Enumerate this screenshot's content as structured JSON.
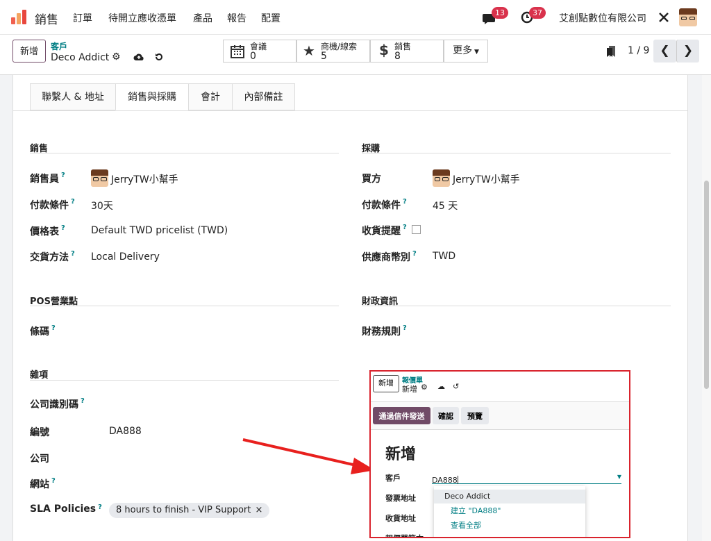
{
  "topbar": {
    "app_name": "銷售",
    "menu": [
      "訂單",
      "待開立應收憑單",
      "產品",
      "報告",
      "配置"
    ],
    "messages_count": "13",
    "activities_count": "37",
    "company": "艾創點數位有限公司"
  },
  "control_panel": {
    "new_label": "新增",
    "breadcrumb_parent": "客戶",
    "record_name": "Deco Addict",
    "smart_buttons": [
      {
        "label": "會議",
        "value": "0",
        "icon": "calendar-icon"
      },
      {
        "label": "商機/線索",
        "value": "5",
        "icon": "star-icon"
      },
      {
        "label": "銷售",
        "value": "8",
        "icon": "dollar-icon"
      }
    ],
    "more_label": "更多",
    "pager": "1 / 9"
  },
  "tabs": [
    "聯繫人 & 地址",
    "銷售與採購",
    "會計",
    "內部備註"
  ],
  "sales": {
    "title": "銷售",
    "salesperson_label": "銷售員",
    "salesperson": "JerryTW小幫手",
    "payment_terms_label": "付款條件",
    "payment_terms": "30天",
    "pricelist_label": "價格表",
    "pricelist": "Default TWD pricelist (TWD)",
    "delivery_label": "交貨方法",
    "delivery": "Local Delivery"
  },
  "purchase": {
    "title": "採購",
    "buyer_label": "買方",
    "buyer": "JerryTW小幫手",
    "payment_terms_label": "付款條件",
    "payment_terms": "45 天",
    "receipt_reminder_label": "收貨提醒",
    "currency_label": "供應商幣別",
    "currency": "TWD"
  },
  "pos": {
    "title": "POS營業點",
    "barcode_label": "條碼"
  },
  "fiscal": {
    "title": "財政資訊",
    "position_label": "財務規則"
  },
  "misc": {
    "title": "雜項",
    "company_id_label": "公司識別碼",
    "ref_label": "編號",
    "ref": "DA888",
    "company_label": "公司",
    "website_label": "網站",
    "sla_label": "SLA Policies",
    "sla_tag": "8 hours to finish - VIP Support",
    "tag_remove": "×"
  },
  "popup": {
    "new_label": "新增",
    "breadcrumb_parent": "報價單",
    "record_name": "新增",
    "send_label": "通過信件發送",
    "confirm_label": "確認",
    "preview_label": "預覽",
    "heading": "新增",
    "customer_label": "客戶",
    "customer_value": "DA888",
    "invoice_addr_label": "發票地址",
    "delivery_addr_label": "收貨地址",
    "template_label": "報價單範本",
    "dropdown": [
      "Deco Addict",
      "建立 \"DA888\"",
      "查看全部"
    ]
  },
  "colors": {
    "accent": "#017e84",
    "primary": "#714b67",
    "highlight_red": "#d9232d",
    "badge": "#d9324c"
  }
}
